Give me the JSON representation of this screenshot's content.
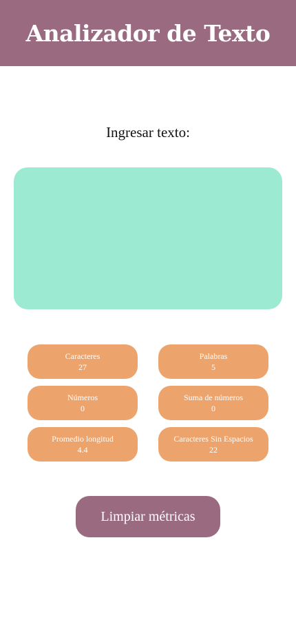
{
  "header": {
    "title": "Analizador de Texto"
  },
  "input": {
    "label": "Ingresar texto:",
    "value": ""
  },
  "metrics": [
    {
      "label": "Caracteres",
      "value": "27"
    },
    {
      "label": "Palabras",
      "value": "5"
    },
    {
      "label": "Números",
      "value": "0"
    },
    {
      "label": "Suma de números",
      "value": "0"
    },
    {
      "label": "Promedio longitud",
      "value": "4.4"
    },
    {
      "label": "Caracteres Sin Espacios",
      "value": "22"
    }
  ],
  "actions": {
    "clear_label": "Limpiar métricas"
  },
  "colors": {
    "header_bg": "#9a6b80",
    "textarea_bg": "#9dead2",
    "metric_bg": "#eda46c",
    "button_bg": "#9a6b80"
  }
}
